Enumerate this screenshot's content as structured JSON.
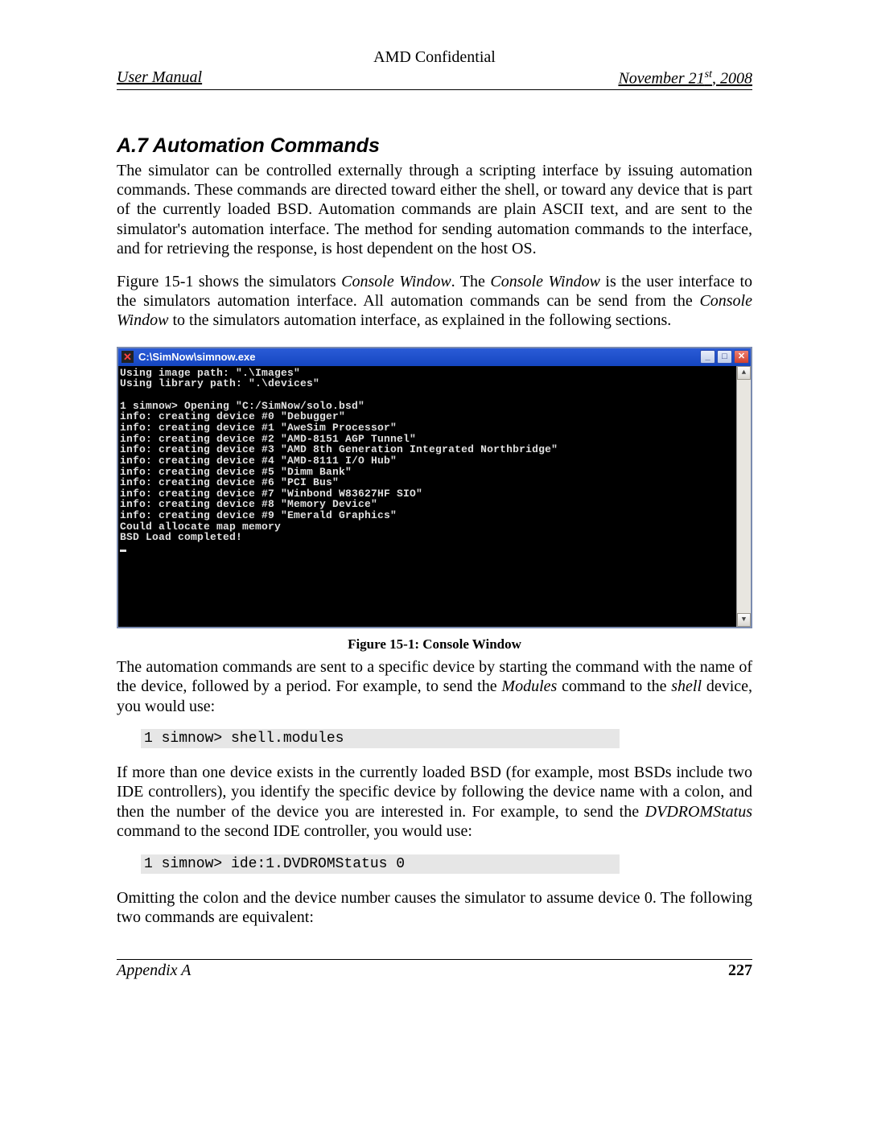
{
  "header": {
    "confidential": "AMD Confidential",
    "left": "User Manual",
    "right_prefix": "November 21",
    "right_sup": "st",
    "right_suffix": ", 2008"
  },
  "section": {
    "title": "A.7  Automation Commands",
    "p1_a": "The simulator can be controlled externally through a scripting interface by issuing automation commands. These commands are directed toward either the shell, or toward any device that is part of the currently loaded BSD. Automation commands are plain ASCII text, and are sent to the simulator's automation interface. The method for sending automation commands to the interface, and for retrieving the response, is host dependent on the host OS.",
    "p2": {
      "a": "Figure 15-1 shows the simulators ",
      "b": "Console Window",
      "c": ". The ",
      "d": "Console Window",
      "e": " is the user interface to the simulators automation interface. All automation commands can be send from the ",
      "f": "Console Window",
      "g": " to the simulators automation interface, as explained in the following sections."
    },
    "figure_caption": "Figure 15-1: Console Window",
    "p3": {
      "a": "The automation commands are sent to a specific device by starting the command with the name of the device, followed by a period. For example, to send the ",
      "b": "Modules",
      "c": " command to the ",
      "d": "shell",
      "e": " device, you would use:"
    },
    "code1": "1 simnow> shell.modules",
    "p4": {
      "a": "If more than one device exists in the currently loaded BSD (for example, most BSDs include two IDE controllers), you identify the specific device by following the device name with a colon, and then the number of the device you are interested in. For example, to send the ",
      "b": "DVDROMStatus",
      "c": " command to the second IDE controller, you would use:"
    },
    "code2": "1 simnow> ide:1.DVDROMStatus 0",
    "p5": "Omitting the colon and the device number causes the simulator to assume device 0. The following two commands are equivalent:"
  },
  "console": {
    "title": "C:\\SimNow\\simnow.exe",
    "lines": [
      "Using image path: \".\\Images\"",
      "Using library path: \".\\devices\"",
      "",
      "1 simnow> Opening \"C:/SimNow/solo.bsd\"",
      "info: creating device #0 \"Debugger\"",
      "info: creating device #1 \"AweSim Processor\"",
      "info: creating device #2 \"AMD-8151 AGP Tunnel\"",
      "info: creating device #3 \"AMD 8th Generation Integrated Northbridge\"",
      "info: creating device #4 \"AMD-8111 I/O Hub\"",
      "info: creating device #5 \"Dimm Bank\"",
      "info: creating device #6 \"PCI Bus\"",
      "info: creating device #7 \"Winbond W83627HF SIO\"",
      "info: creating device #8 \"Memory Device\"",
      "info: creating device #9 \"Emerald Graphics\"",
      "Could allocate map memory",
      "BSD Load completed!"
    ]
  },
  "footer": {
    "left": "Appendix A",
    "right": "227"
  }
}
